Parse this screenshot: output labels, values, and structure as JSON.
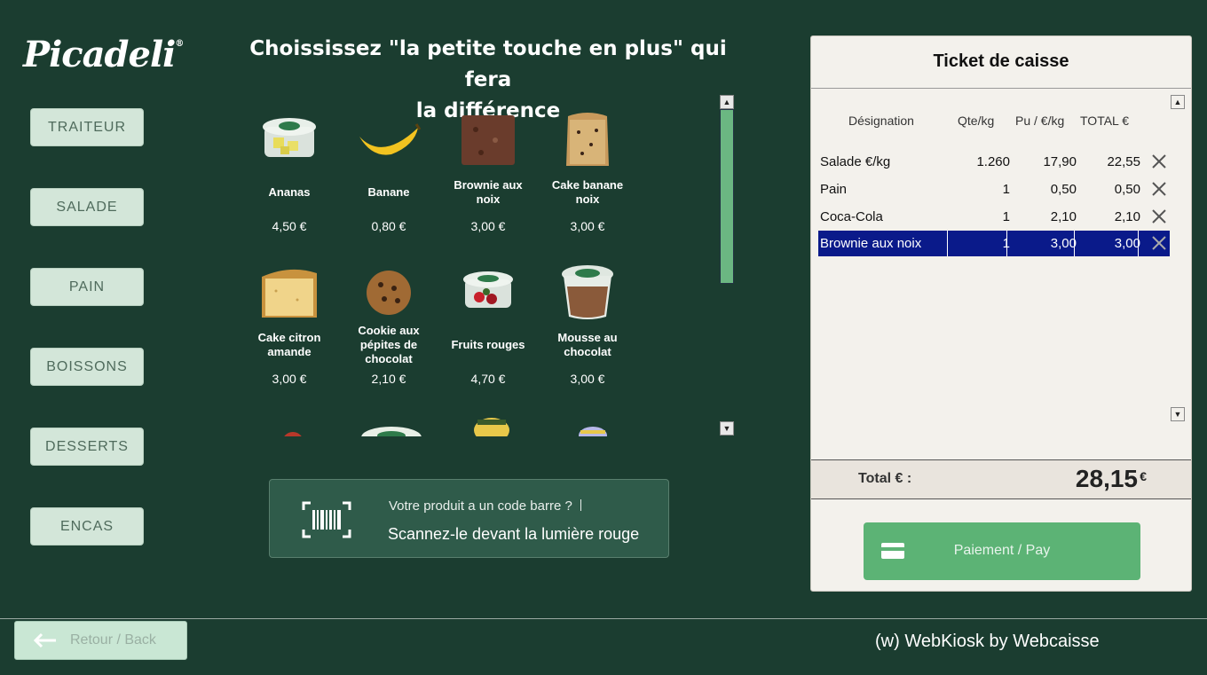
{
  "brand": {
    "logo_text": "Picadeli",
    "logo_mark": "®"
  },
  "sidebar": {
    "categories": [
      {
        "label": "TRAITEUR"
      },
      {
        "label": "SALADE"
      },
      {
        "label": "PAIN"
      },
      {
        "label": "BOISSONS"
      },
      {
        "label": "DESSERTS"
      },
      {
        "label": "ENCAS"
      }
    ]
  },
  "main": {
    "title_line1": "Choississez \"la petite touche en plus\" qui fera",
    "title_line2": "la différence",
    "products": [
      {
        "name": "Ananas",
        "price": "4,50 €",
        "icon": "pineapple-cup-icon"
      },
      {
        "name": "Banane",
        "price": "0,80 €",
        "icon": "banana-icon"
      },
      {
        "name": "Brownie aux noix",
        "price": "3,00 €",
        "icon": "brownie-icon"
      },
      {
        "name": "Cake banane noix",
        "price": "3,00 €",
        "icon": "banana-cake-icon"
      },
      {
        "name": "Cake citron amande",
        "price": "3,00 €",
        "icon": "lemon-cake-icon"
      },
      {
        "name": "Cookie aux pépites de chocolat",
        "price": "2,10 €",
        "icon": "cookie-icon"
      },
      {
        "name": "Fruits rouges",
        "price": "4,70 €",
        "icon": "red-fruits-cup-icon"
      },
      {
        "name": "Mousse au chocolat",
        "price": "3,00 €",
        "icon": "chocolate-mousse-icon"
      }
    ],
    "scan_question": "Votre produit a un code barre ?",
    "scan_instruction": "Scannez-le devant la lumière rouge"
  },
  "ticket": {
    "title": "Ticket de caisse",
    "columns": [
      "Désignation",
      "Qte/kg",
      "Pu / €/kg",
      "TOTAL €"
    ],
    "rows": [
      {
        "name": "Salade €/kg",
        "qty": "1.260",
        "unit": "17,90",
        "total": "22,55",
        "selected": false
      },
      {
        "name": "Pain",
        "qty": "1",
        "unit": "0,50",
        "total": "0,50",
        "selected": false
      },
      {
        "name": "Coca-Cola",
        "qty": "1",
        "unit": "2,10",
        "total": "2,10",
        "selected": false
      },
      {
        "name": "Brownie aux noix",
        "qty": "1",
        "unit": "3,00",
        "total": "3,00",
        "selected": true
      }
    ],
    "total_label": "Total € :",
    "total_value": "28,15",
    "total_currency": "€",
    "pay_label": "Paiement / Pay"
  },
  "footer": {
    "back_label": "Retour / Back",
    "credit": "(w) WebKiosk by Webcaisse"
  },
  "colors": {
    "background": "#1b3d30",
    "accent": "#5cb375",
    "selection": "#0a1a8a"
  }
}
